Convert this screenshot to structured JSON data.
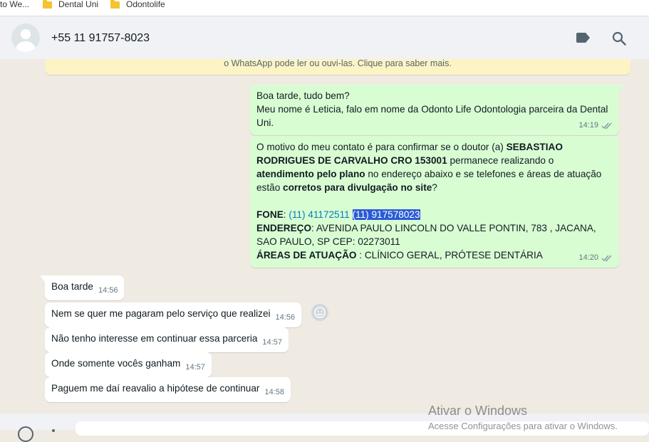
{
  "bookmarks": [
    {
      "label": "to We..."
    },
    {
      "label": "Dental Uni"
    },
    {
      "label": "Odontolife"
    }
  ],
  "header": {
    "contact_name": "+55 11 91757-8023"
  },
  "notice": {
    "text": "o WhatsApp pode ler ou ouvi-las. Clique para saber mais."
  },
  "messages": {
    "outgoing": [
      {
        "line1": "Boa tarde, tudo bem?",
        "line2": "Meu nome é Leticia, falo em nome da Odonto Life Odontologia parceira da Dental Uni.",
        "time": "14:19"
      },
      {
        "p1_a": "O motivo do meu contato é para confirmar se o doutor (a) ",
        "p1_b": "SEBASTIAO RODRIGUES DE CARVALHO  CRO 153001",
        "p1_c": " permanece realizando o ",
        "p1_d": "atendimento pelo plano",
        "p1_e": " no endereço abaixo e se telefones e áreas de atuação estão ",
        "p1_f": "corretos para divulgação no site",
        "p1_g": "?",
        "fone_label": "FONE",
        "fone_sep": ": ",
        "fone_1": "(11) 41172511",
        "fone_2": "(11) 917578023",
        "endereco_label": "ENDEREÇO",
        "endereco_value": ": AVENIDA PAULO LINCOLN DO VALLE PONTIN, 783 , JACANA, SAO PAULO, SP CEP: 02273011",
        "areas_label": "ÁREAS DE ATUAÇÃO",
        "areas_value": " : CLÍNICO GERAL, PRÓTESE DENTÁRIA",
        "time": "14:20"
      }
    ],
    "incoming": [
      {
        "text": "Boa tarde",
        "time": "14:56"
      },
      {
        "text": "Nem se quer me pagaram pelo serviço que realizei",
        "time": "14:56"
      },
      {
        "text": "Não tenho interesse em continuar essa parceria",
        "time": "14:57"
      },
      {
        "text": "Onde somente vocês ganham",
        "time": "14:57"
      },
      {
        "text": "Paguem me daí reavalio a hipótese de continuar",
        "time": "14:58"
      }
    ]
  },
  "watermark": {
    "title": "Ativar o Windows",
    "subtitle": "Acesse Configurações para ativar o Windows."
  },
  "colors": {
    "outgoing_bubble": "#d9fdd3",
    "incoming_bubble": "#ffffff",
    "chat_background": "#efeae2",
    "notice_background": "#fdf4c5",
    "selection": "#2a5bd7",
    "link": "#027eb5"
  },
  "icons": [
    "folder-icon",
    "default-avatar-icon",
    "label-icon",
    "search-icon",
    "double-check-icon",
    "emoji-icon",
    "attach-icon"
  ]
}
